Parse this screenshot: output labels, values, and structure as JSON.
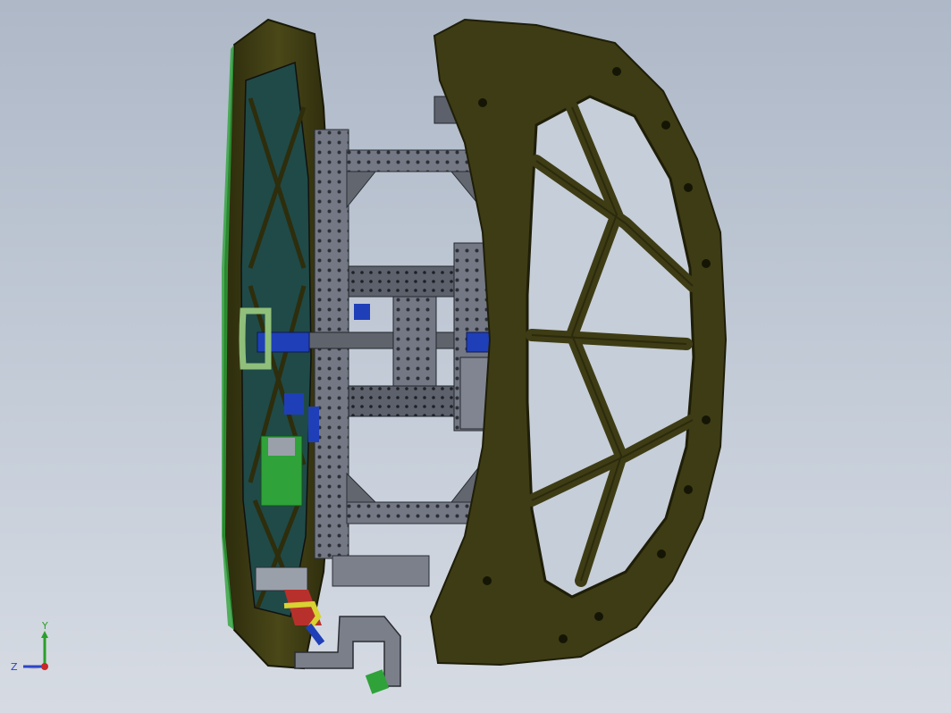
{
  "viewport": {
    "background_top": "#aeb8c7",
    "background_bottom": "#d6dbe3"
  },
  "model": {
    "frame_color": "#3e3c14",
    "frame_edge_color": "#1f1e08",
    "fixture_color": "#6f7480",
    "fixture_dark": "#3d414a",
    "accent_blue": "#1f3fb8",
    "accent_green": "#2fa23a",
    "accent_red": "#b8302c",
    "accent_yellow": "#d8d232",
    "inner_panel_color": "#1f4a48"
  },
  "triad": {
    "y_label": "Y",
    "z_label": "Z",
    "y_color": "#2aa02a",
    "z_color": "#2a45c8",
    "x_color": "#c8282a"
  }
}
